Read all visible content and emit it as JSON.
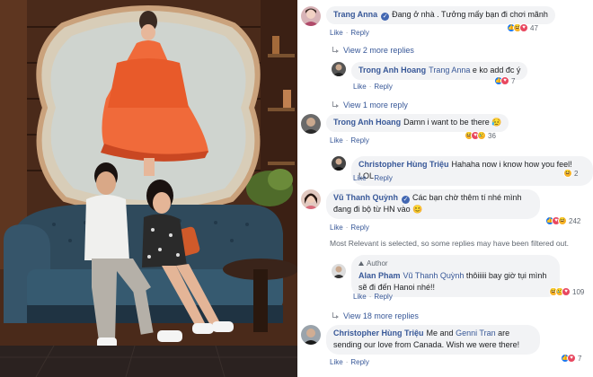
{
  "comments": [
    {
      "id": "c1",
      "author": "Trang Anna",
      "verified": true,
      "text": "Đang ở nhà . Tưởng mấy bạn đi chơi mãnh",
      "like": "Like",
      "reply": "Reply",
      "reactions": [
        "like",
        "haha",
        "love"
      ],
      "reaction_count": "47"
    },
    {
      "id": "c1-more",
      "label": "View 2 more replies"
    },
    {
      "id": "c1r1",
      "author": "Trong Anh Hoang",
      "mention": "Trang Anna",
      "text": "e ko add đc ý",
      "like": "Like",
      "reply": "Reply",
      "reactions": [
        "like",
        "love"
      ],
      "reaction_count": "7"
    },
    {
      "id": "c1-more2",
      "label": "View 1 more reply"
    },
    {
      "id": "c2",
      "author": "Trong Anh Hoang",
      "text": "Damn i want to be there",
      "emoji": "😥",
      "like": "Like",
      "reply": "Reply",
      "reactions": [
        "haha",
        "love",
        "sad"
      ],
      "reaction_count": "36"
    },
    {
      "id": "c2r1",
      "author": "Christopher Hùng Triệu",
      "text": "Hahaha now i know how you feel! LOL",
      "like": "Like",
      "reply": "Reply",
      "reactions": [
        "haha"
      ],
      "reaction_count": "2"
    },
    {
      "id": "c3",
      "author": "Vũ Thanh Quỳnh",
      "verified": true,
      "text": "Các bạn chờ thêm tí nhé mình đang đi bộ từ HN vào",
      "emoji": "😊",
      "like": "Like",
      "reply": "Reply",
      "reactions": [
        "like",
        "love",
        "haha"
      ],
      "reaction_count": "242"
    },
    {
      "id": "notice",
      "label": "Most Relevant is selected, so some replies may have been filtered out."
    },
    {
      "id": "c3r1",
      "author_badge": "Author",
      "author": "Alan Pham",
      "mention": "Vũ Thanh Quỳnh",
      "text": "thôiiiii bay giờ tụi mình sẽ đi đến Hanoi nhé!!",
      "like": "Like",
      "reply": "Reply",
      "reactions": [
        "haha",
        "sad",
        "love"
      ],
      "reaction_count": "109"
    },
    {
      "id": "c3-more",
      "label": "View 18 more replies"
    },
    {
      "id": "c4",
      "author": "Christopher Hùng Triệu",
      "text": "Me and",
      "mention": "Genni Tran",
      "text_after": "are sending our love from Canada. Wish we were there!",
      "like": "Like",
      "reply": "Reply",
      "reactions": [
        "like",
        "love"
      ],
      "reaction_count": "7"
    }
  ],
  "reaction_glyphs": {
    "like": "👍",
    "love": "♥",
    "haha": "😆",
    "sad": "😢"
  },
  "colors": {
    "link": "#385898",
    "bubble": "#f2f3f5",
    "meta": "#606770",
    "like": "#1877f2",
    "love": "#e8475f",
    "haha": "#f7b125"
  }
}
